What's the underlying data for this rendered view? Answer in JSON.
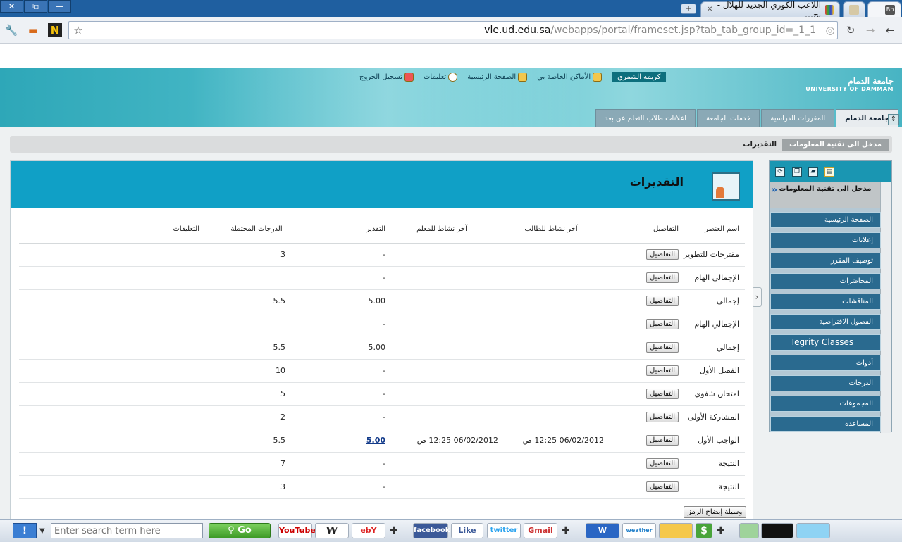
{
  "window": {
    "close": "✕",
    "restore": "⧉",
    "minimize": "—"
  },
  "browser": {
    "tabs": [
      {
        "label": "Bb",
        "active": true
      },
      {
        "label": "",
        "active": false
      },
      {
        "label": "اللاعب الكوري الجديد للهلال - بح…",
        "active": false
      }
    ],
    "url_host": "vle.ud.edu.sa",
    "url_path": "/webapps/portal/frameset.jsp?tab_tab_group_id=_1_1"
  },
  "header": {
    "university_ar": "جامعة الدمام",
    "university_en": "UNIVERSITY OF DAMMAM",
    "user_name": "كريمه الشمري",
    "top_links": [
      "الأماكن الخاصة بي",
      "الصفحة الرئيسية",
      "تعليمات",
      "تسجيل الخروج"
    ],
    "nav_tabs": [
      "جامعة الدمام",
      "المقررات الدراسية",
      "خدمات الجامعة",
      "اعلانات طلاب التعلم عن بعد"
    ]
  },
  "breadcrumb": {
    "course": "مدخل الى تقنية المعلومات",
    "current": "التقديرات"
  },
  "course_menu": {
    "title": "مدخل الى تقنية المعلومات",
    "items": [
      "الصفحة الرئيسية",
      "إعلانات",
      "توصيف المقرر",
      "المحاضرات",
      "المناقشات",
      "الفصول الافتراضية",
      "Tegrity Classes",
      "أدوات",
      "الدرجات",
      "المجموعات",
      "المساعدة"
    ]
  },
  "page": {
    "title": "التقديرات",
    "columns": [
      "اسم العنصر",
      "التفاصيل",
      "آخر نشاط للطالب",
      "آخر نشاط للمعلم",
      "التقدير",
      "الدرجات المحتملة",
      "التعليقات"
    ],
    "details_label": "التفاصيل",
    "rows": [
      {
        "name": "مقترحات للتطوير",
        "student": "",
        "instructor": "",
        "grade": "-",
        "points": "3",
        "link": false
      },
      {
        "name": "الإجمالي الهام",
        "student": "",
        "instructor": "",
        "grade": "-",
        "points": "",
        "link": false
      },
      {
        "name": "إجمالي",
        "student": "",
        "instructor": "",
        "grade": "5.00",
        "points": "5.5",
        "link": false
      },
      {
        "name": "الإجمالي الهام",
        "student": "",
        "instructor": "",
        "grade": "-",
        "points": "",
        "link": false
      },
      {
        "name": "إجمالي",
        "student": "",
        "instructor": "",
        "grade": "5.00",
        "points": "5.5",
        "link": false
      },
      {
        "name": "الفصل الأول",
        "student": "",
        "instructor": "",
        "grade": "-",
        "points": "10",
        "link": false
      },
      {
        "name": "امتحان شفوي",
        "student": "",
        "instructor": "",
        "grade": "-",
        "points": "5",
        "link": false
      },
      {
        "name": "المشاركة الأولى",
        "student": "",
        "instructor": "",
        "grade": "-",
        "points": "2",
        "link": false
      },
      {
        "name": "الواجب الأول",
        "student": "06/02/2012 12:25 ص",
        "instructor": "06/02/2012 12:25 ص",
        "grade": "5.00",
        "points": "5.5",
        "link": true
      },
      {
        "name": "النتيجة",
        "student": "",
        "instructor": "",
        "grade": "-",
        "points": "7",
        "link": false
      },
      {
        "name": "النتيجة",
        "student": "",
        "instructor": "",
        "grade": "-",
        "points": "3",
        "link": false
      }
    ],
    "legend_button": "وسيلة إيضاح الرمز"
  },
  "bottom_toolbar": {
    "help": "!",
    "search_placeholder": "Enter search term here",
    "go": "Go",
    "apps": [
      "YouTube",
      "W",
      "ebY",
      "facebook",
      "Like",
      "twitter",
      "Gmail",
      "W",
      "weather",
      "dollar"
    ]
  },
  "colors": {
    "banner": "#2ea7b8",
    "content_header": "#10a0c6",
    "menu_item": "#2a6a8f",
    "go_button": "#3d9a26"
  }
}
